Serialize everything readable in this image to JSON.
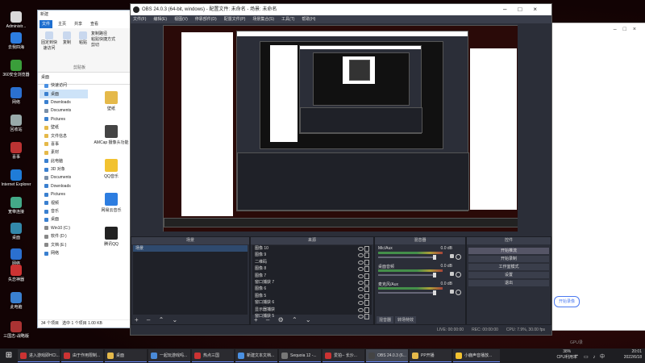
{
  "desktop": {
    "icons": [
      {
        "label": "Administr...",
        "color": "#d9d9d9"
      },
      {
        "label": "去我四海",
        "color": "#2d7de0"
      },
      {
        "label": "360安全浏览器",
        "color": "#3a9e3a"
      },
      {
        "label": "网络",
        "color": "#2b70d0"
      },
      {
        "label": "回收站",
        "color": "#9aa"
      },
      {
        "label": "喜事",
        "color": "#b33"
      },
      {
        "label": "Internet Explorer",
        "color": "#1f7cd8"
      },
      {
        "label": "宽带连接",
        "color": "#4a8"
      },
      {
        "label": "桌面",
        "color": "#38a"
      },
      {
        "label": "网络",
        "color": "#2b70d0"
      },
      {
        "label": "失恋神器",
        "color": "#c33"
      },
      {
        "label": "此电脑",
        "color": "#3a80d0"
      },
      {
        "label": "三国志-战略版",
        "color": "#a33"
      }
    ]
  },
  "explorer": {
    "title": "新建",
    "tabs": [
      "文件",
      "主页",
      "共享",
      "查看"
    ],
    "ribbon": {
      "pin": "固定到快速访问",
      "copy": "复制",
      "paste": "粘贴",
      "copy_path": "复制路径",
      "paste_shortcut": "粘贴快捷方式",
      "cut": "剪切",
      "group": "剪贴板"
    },
    "address": "桌面",
    "nav": [
      {
        "label": "快速访问",
        "color": "#4a90e2"
      },
      {
        "label": "桌面",
        "color": "#3a80d0",
        "selected": true
      },
      {
        "label": "Downloads",
        "color": "#3a80d0"
      },
      {
        "label": "Documents",
        "color": "#7a8fa8"
      },
      {
        "label": "Pictures",
        "color": "#3a80d0"
      },
      {
        "label": "壁纸",
        "color": "#e5b94a"
      },
      {
        "label": "文件信息",
        "color": "#e5b94a"
      },
      {
        "label": "喜事",
        "color": "#e5b94a"
      },
      {
        "label": "素材",
        "color": "#e5b94a"
      },
      {
        "label": "此电脑",
        "color": "#3a80d0"
      },
      {
        "label": "3D 对象",
        "color": "#3a80d0"
      },
      {
        "label": "Documents",
        "color": "#7a8fa8"
      },
      {
        "label": "Downloads",
        "color": "#3a80d0"
      },
      {
        "label": "Pictures",
        "color": "#3a80d0"
      },
      {
        "label": "视频",
        "color": "#3a80d0"
      },
      {
        "label": "音乐",
        "color": "#3a80d0"
      },
      {
        "label": "桌面",
        "color": "#3a80d0"
      },
      {
        "label": "Win10 (C:)",
        "color": "#888"
      },
      {
        "label": "软件 (D:)",
        "color": "#888"
      },
      {
        "label": "文档 (E:)",
        "color": "#888"
      },
      {
        "label": "网络",
        "color": "#3a80d0"
      }
    ],
    "files": [
      {
        "label": "壁纸",
        "color": "#e5b94a"
      },
      {
        "label": "AMCap 摄像头功能",
        "color": "#444"
      },
      {
        "label": "QQ音乐",
        "color": "#f2c230"
      },
      {
        "label": "网易云音乐",
        "color": "#2d7de0"
      },
      {
        "label": "腾讯QQ",
        "color": "#222"
      }
    ],
    "status_count": "34 个项目",
    "status_selected": "选中 1 个项目  1.00 KB"
  },
  "obs": {
    "title": "OBS 24.0.3 (64-bit, windows) - 配置文件: 未命名 - 场景: 未命名",
    "menu": [
      "文件(F)",
      "编辑(E)",
      "视图(V)",
      "停靠部件(D)",
      "配置文件(P)",
      "场景集合(S)",
      "工具(T)",
      "帮助(H)"
    ],
    "scenes": {
      "header": "场景",
      "items": [
        {
          "label": "场景",
          "selected": true
        }
      ]
    },
    "sources": {
      "header": "来源",
      "items": [
        "图像 10",
        "图像 9",
        "二维码",
        "图像 8",
        "图像 7",
        "窗口捕获 7",
        "图像 6",
        "图像 5",
        "窗口捕获 6",
        "显示器捕获",
        "窗口捕获 5"
      ]
    },
    "mixer": {
      "header": "混音器",
      "channels": [
        {
          "name": "Mic/Aux",
          "db": "0.0 dB"
        },
        {
          "name": "桌面音频",
          "db": "0.0 dB"
        },
        {
          "name": "麦克风/Aux",
          "db": "0.0 dB"
        }
      ],
      "tabs": [
        "混音器",
        "转场特效"
      ]
    },
    "controls": {
      "header": "控件",
      "buttons": [
        "开始推流",
        "开始录制",
        "工作室模式",
        "设置",
        "退出"
      ]
    },
    "status": {
      "live": "LIVE: 00:00:00",
      "rec": "REC: 00:00:00",
      "cpu": "CPU: 7.9%, 30.00 fps"
    }
  },
  "right_window": {
    "start_button": "开始录像",
    "caption": "GPU录"
  },
  "taskbar": {
    "buttons": [
      {
        "label": "进入游戏即HCI...",
        "color": "#c33",
        "width": 52
      },
      {
        "label": "由于作用限制...",
        "color": "#c33",
        "width": 52
      },
      {
        "label": "桌面",
        "color": "#e5b94a",
        "width": 52
      },
      {
        "label": "一起玩游戏吗...",
        "color": "#4a8ad8",
        "width": 52
      },
      {
        "label": "热点三国",
        "color": "#c33",
        "width": 52
      },
      {
        "label": "新建文本文档...",
        "color": "#4a90e2",
        "width": 52
      },
      {
        "label": "Sequoia 12 -...",
        "color": "#777",
        "width": 52
      },
      {
        "label": "爱拍-- 长沙...",
        "color": "#c33",
        "width": 52
      },
      {
        "label": "OBS 24.0.3 (6...",
        "color": "#444",
        "width": 52,
        "active": true
      },
      {
        "label": "PP开播",
        "color": "#e5b94a",
        "width": 52
      },
      {
        "label": "小鹿声音播放...",
        "color": "#f2c230",
        "width": 58
      }
    ],
    "perf_label1": "38%",
    "perf_label2": "CPU利用率",
    "time": "20:01",
    "date": "2022/6/18"
  }
}
